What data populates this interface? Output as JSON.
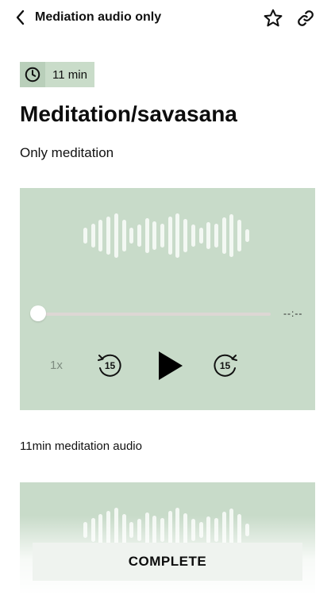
{
  "header": {
    "title": "Mediation audio only",
    "back_icon": "chevron-left-icon",
    "favorite_icon": "star-icon",
    "share_icon": "link-icon"
  },
  "duration_badge": {
    "icon": "clock-icon",
    "label": "11 min"
  },
  "page": {
    "title": "Meditation/savasana",
    "subtitle": "Only meditation"
  },
  "player": {
    "time": "--:--",
    "speed": "1x",
    "rewind_seconds": "15",
    "forward_seconds": "15",
    "progress": 0
  },
  "caption": "11min meditation audio",
  "complete_button": {
    "label": "COMPLETE"
  },
  "colors": {
    "player_bg": "#c8dbc9",
    "badge_bg": "#c9dcc9",
    "wave": "#f3f8f3"
  }
}
